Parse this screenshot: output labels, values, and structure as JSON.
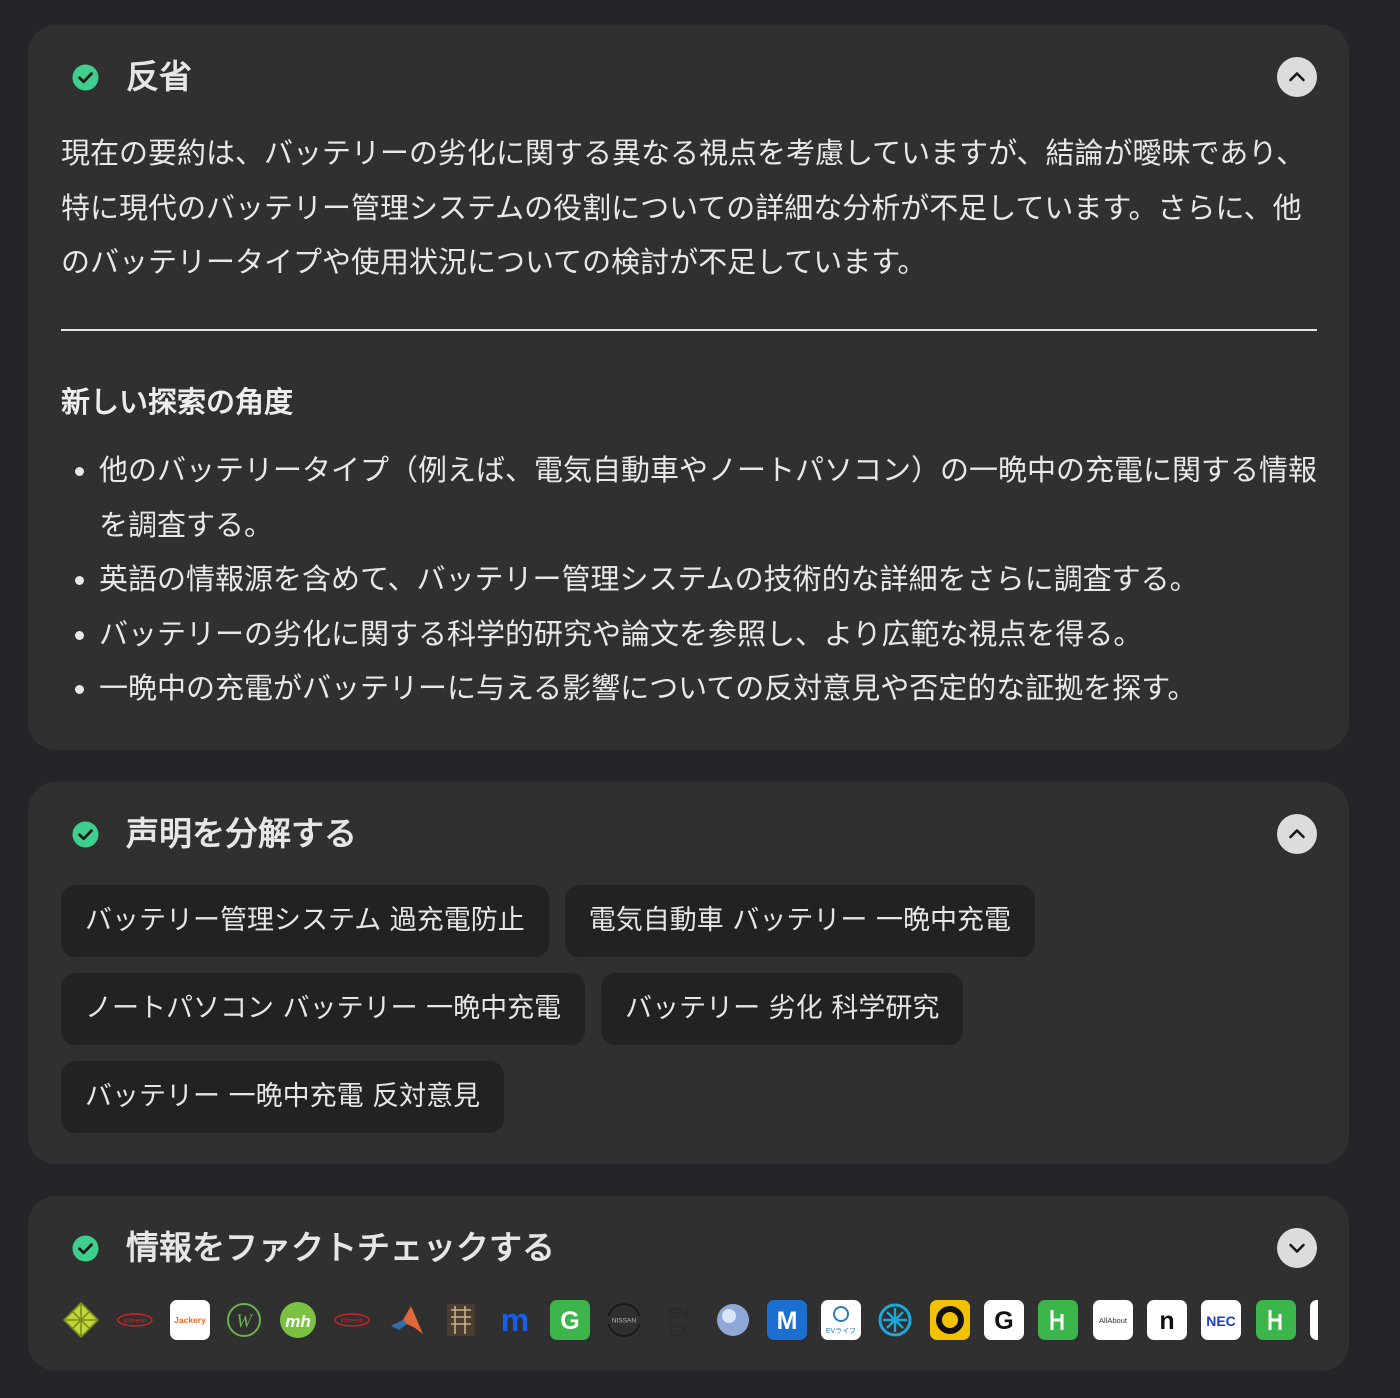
{
  "reflection": {
    "title": "反省",
    "status_icon": "check-circle-icon",
    "toggle_icon": "chevron-up-icon",
    "summary": "現在の要約は、バッテリーの劣化に関する異なる視点を考慮していますが、結論が曖昧であり、特に現代のバッテリー管理システムの役割についての詳細な分析が不足しています。さらに、他のバッテリータイプや使用状況についての検討が不足しています。",
    "new_angles_heading": "新しい探索の角度",
    "new_angles": [
      "他のバッテリータイプ（例えば、電気自動車やノートパソコン）の一晩中の充電に関する情報を調査する。",
      "英語の情報源を含めて、バッテリー管理システムの技術的な詳細をさらに調査する。",
      "バッテリーの劣化に関する科学的研究や論文を参照し、より広範な視点を得る。",
      "一晩中の充電がバッテリーに与える影響についての反対意見や否定的な証拠を探す。"
    ]
  },
  "decompose": {
    "title": "声明を分解する",
    "status_icon": "check-circle-icon",
    "toggle_icon": "chevron-up-icon",
    "queries": [
      "バッテリー管理システム 過充電防止",
      "電気自動車 バッテリー 一晩中充電",
      "ノートパソコン バッテリー 一晩中充電",
      "バッテリー 劣化 科学研究",
      "バッテリー 一晩中充電 反対意見"
    ]
  },
  "factcheck": {
    "title": "情報をファクトチェックする",
    "status_icon": "check-circle-icon",
    "toggle_icon": "chevron-down-icon",
    "sources": [
      {
        "icon": "diamond-grid-logo-icon",
        "text": "",
        "bg": "transparent",
        "fg": "#c4d43a"
      },
      {
        "icon": "infineon-logo-icon",
        "text": "infineon",
        "bg": "transparent",
        "fg": "#d2232a"
      },
      {
        "icon": "jackery-logo-icon",
        "text": "Jackery",
        "bg": "#ffffff",
        "fg": "#f26522"
      },
      {
        "icon": "w-circle-logo-icon",
        "text": "W",
        "bg": "transparent",
        "fg": "#6ab04c"
      },
      {
        "icon": "mh-green-logo-icon",
        "text": "mh",
        "bg": "#7cc242",
        "fg": "#ffffff"
      },
      {
        "icon": "infineon-logo-icon",
        "text": "infineon",
        "bg": "transparent",
        "fg": "#d2232a"
      },
      {
        "icon": "matlab-logo-icon",
        "text": "",
        "bg": "transparent",
        "fg": "#e16737"
      },
      {
        "icon": "kanji-logo-icon",
        "text": "",
        "bg": "transparent",
        "fg": "#5a4a3a"
      },
      {
        "icon": "m-blue-logo-icon",
        "text": "m",
        "bg": "transparent",
        "fg": "#1a5ee8"
      },
      {
        "icon": "g-green-logo-icon",
        "text": "G",
        "bg": "#3cb54a",
        "fg": "#ffffff"
      },
      {
        "icon": "nissan-logo-icon",
        "text": "NISSAN",
        "bg": "transparent",
        "fg": "#1a1a1a"
      },
      {
        "icon": "enex-logo-icon",
        "text": "EN EX",
        "bg": "transparent",
        "fg": "#2a2a2a"
      },
      {
        "icon": "globe-logo-icon",
        "text": "",
        "bg": "transparent",
        "fg": "#8fa8d8"
      },
      {
        "icon": "m-square-logo-icon",
        "text": "M",
        "bg": "#1b6fd1",
        "fg": "#ffffff"
      },
      {
        "icon": "ev-life-logo-icon",
        "text": "EVライフ",
        "bg": "#ffffff",
        "fg": "#2b7bb9"
      },
      {
        "icon": "spark-logo-icon",
        "text": "",
        "bg": "transparent",
        "fg": "#1ea7d8"
      },
      {
        "icon": "ring-yellow-logo-icon",
        "text": "",
        "bg": "#f2c200",
        "fg": "#111111"
      },
      {
        "icon": "g-white-logo-icon",
        "text": "G",
        "bg": "#ffffff",
        "fg": "#111111"
      },
      {
        "icon": "h-green-logo-icon",
        "text": "H",
        "bg": "#3cb54a",
        "fg": "#ffffff"
      },
      {
        "icon": "allabout-logo-icon",
        "text": "AllAbout",
        "bg": "#ffffff",
        "fg": "#333333"
      },
      {
        "icon": "n-white-logo-icon",
        "text": "n",
        "bg": "#ffffff",
        "fg": "#111111"
      },
      {
        "icon": "nec-logo-icon",
        "text": "NEC",
        "bg": "#ffffff",
        "fg": "#1d3fbf"
      },
      {
        "icon": "h-green-logo-icon",
        "text": "H",
        "bg": "#3cb54a",
        "fg": "#ffffff"
      },
      {
        "icon": "partial-logo-icon",
        "text": "",
        "bg": "#ffffff",
        "fg": "#111111"
      }
    ]
  },
  "colors": {
    "page_bg": "#242528",
    "card_bg": "#303030",
    "chip_bg": "#222222",
    "check_green": "#3ecf8e",
    "toggle_bg": "#dcdcdc",
    "text": "#e8e8e8"
  }
}
